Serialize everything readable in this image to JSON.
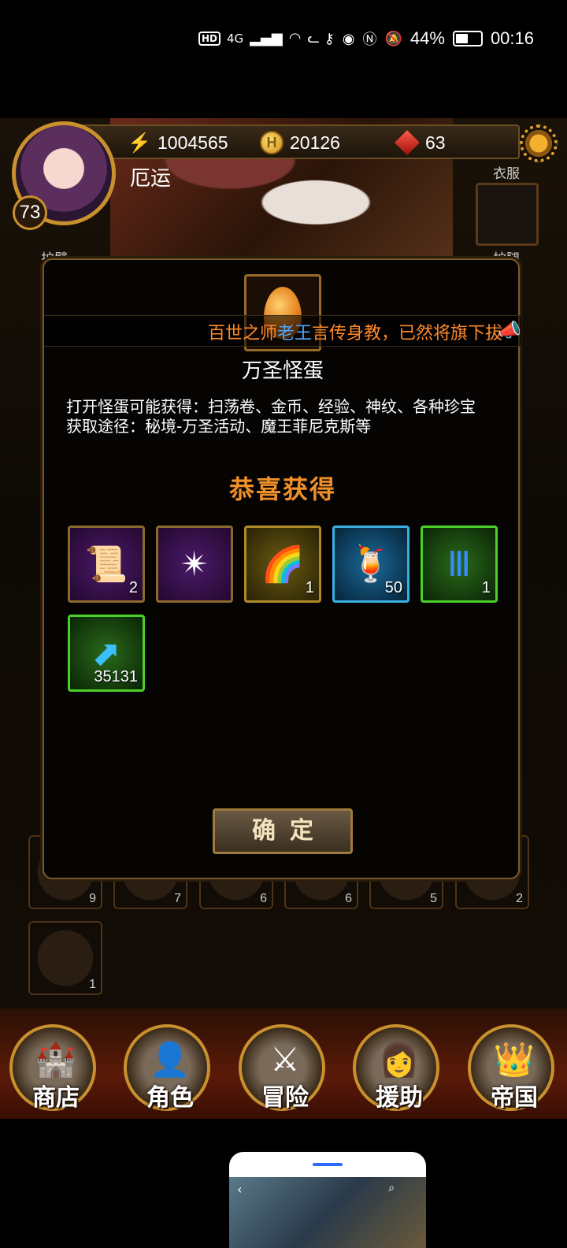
{
  "status_bar": {
    "network": "HD",
    "signal": "4G",
    "battery": "44%",
    "time": "00:16"
  },
  "player": {
    "power": "1004565",
    "gold": "20126",
    "gems": "63",
    "level": "73",
    "name": "厄运"
  },
  "equipment_labels": {
    "clothes": "衣服",
    "armguard": "护臂",
    "legguard": "护腿"
  },
  "inventory_counts": [
    "9",
    "7",
    "6",
    "6",
    "5",
    "2",
    "1"
  ],
  "modal": {
    "marquee_prefix": "百世之师",
    "marquee_highlight": "老王",
    "marquee_suffix": "言传身教，已然将旗下拔",
    "item_title": "万圣怪蛋",
    "description_line1": "打开怪蛋可能获得：扫荡卷、金币、经验、神纹、各种珍宝",
    "description_line2": "获取途径：秘境-万圣活动、魔王菲尼克斯等",
    "congrats": "恭喜获得",
    "confirm_label": "确定"
  },
  "rewards": [
    {
      "icon": "scroll-icon",
      "count": "2"
    },
    {
      "icon": "star-crystal-icon",
      "count": ""
    },
    {
      "icon": "rainbow-orb-icon",
      "count": "1"
    },
    {
      "icon": "cocktail-icon",
      "count": "50"
    },
    {
      "icon": "rune-icon",
      "count": "1"
    },
    {
      "icon": "exp-arrow-icon",
      "count": "35131"
    }
  ],
  "nav": {
    "shop": "商店",
    "character": "角色",
    "adventure": "冒险",
    "assist": "援助",
    "empire": "帝国"
  },
  "mini_window": {
    "text": ""
  }
}
